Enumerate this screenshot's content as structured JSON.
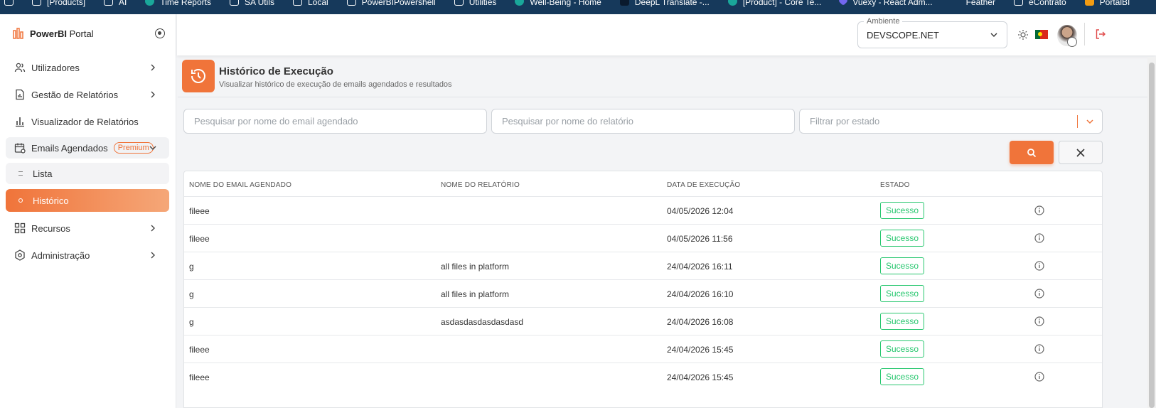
{
  "bookmarks": [
    "[Products]",
    "AI",
    "Time Reports",
    "SA Utils",
    "Local",
    "PowerBIPowershell",
    "Utilities",
    "Well-Being - Home",
    "DeepL Translate -...",
    "[Product] - Core Te...",
    "Vuexy - React Adm...",
    "Feather",
    "eContrato",
    "PortalBI"
  ],
  "brand": {
    "name_bold": "PowerBI",
    "name_rest": " Portal"
  },
  "sidebar": {
    "items": [
      {
        "label": "Utilizadores",
        "icon": "users-icon"
      },
      {
        "label": "Gestão de Relatórios",
        "icon": "file-chart-icon"
      },
      {
        "label": "Visualizador de Relatórios",
        "icon": "bar-chart-icon"
      },
      {
        "label": "Emails Agendados",
        "icon": "calendar-icon",
        "badge": "Premium"
      },
      {
        "label": "Lista"
      },
      {
        "label": "Histórico"
      },
      {
        "label": "Recursos",
        "icon": "grid-icon"
      },
      {
        "label": "Administração",
        "icon": "shield-icon"
      }
    ]
  },
  "topbar": {
    "env_label": "Ambiente",
    "env_value": "DEVSCOPE.NET"
  },
  "header": {
    "title": "Histórico de Execução",
    "subtitle": "Visualizar histórico de execução de emails agendados e resultados"
  },
  "filters": {
    "email_placeholder": "Pesquisar por nome do email agendado",
    "report_placeholder": "Pesquisar por nome do relatório",
    "status_placeholder": "Filtrar por estado"
  },
  "table": {
    "columns": [
      "NOME DO EMAIL AGENDADO",
      "NOME DO RELATÓRIO",
      "DATA DE EXECUÇÃO",
      "ESTADO"
    ],
    "rows": [
      {
        "email": "fileee",
        "report": "",
        "date": "04/05/2026 12:04",
        "status": "Sucesso"
      },
      {
        "email": "fileee",
        "report": "",
        "date": "04/05/2026 11:56",
        "status": "Sucesso"
      },
      {
        "email": "g",
        "report": "all files in platform",
        "date": "24/04/2026 16:11",
        "status": "Sucesso"
      },
      {
        "email": "g",
        "report": "all files in platform",
        "date": "24/04/2026 16:10",
        "status": "Sucesso"
      },
      {
        "email": "g",
        "report": "asdasdasdasdasdasd",
        "date": "24/04/2026 16:08",
        "status": "Sucesso"
      },
      {
        "email": "fileee",
        "report": "",
        "date": "24/04/2026 15:45",
        "status": "Sucesso"
      },
      {
        "email": "fileee",
        "report": "",
        "date": "24/04/2026 15:45",
        "status": "Sucesso"
      }
    ]
  },
  "colors": {
    "accent": "#f0743a",
    "success": "#28c76f",
    "bookmarks_bg": "#16395b"
  }
}
